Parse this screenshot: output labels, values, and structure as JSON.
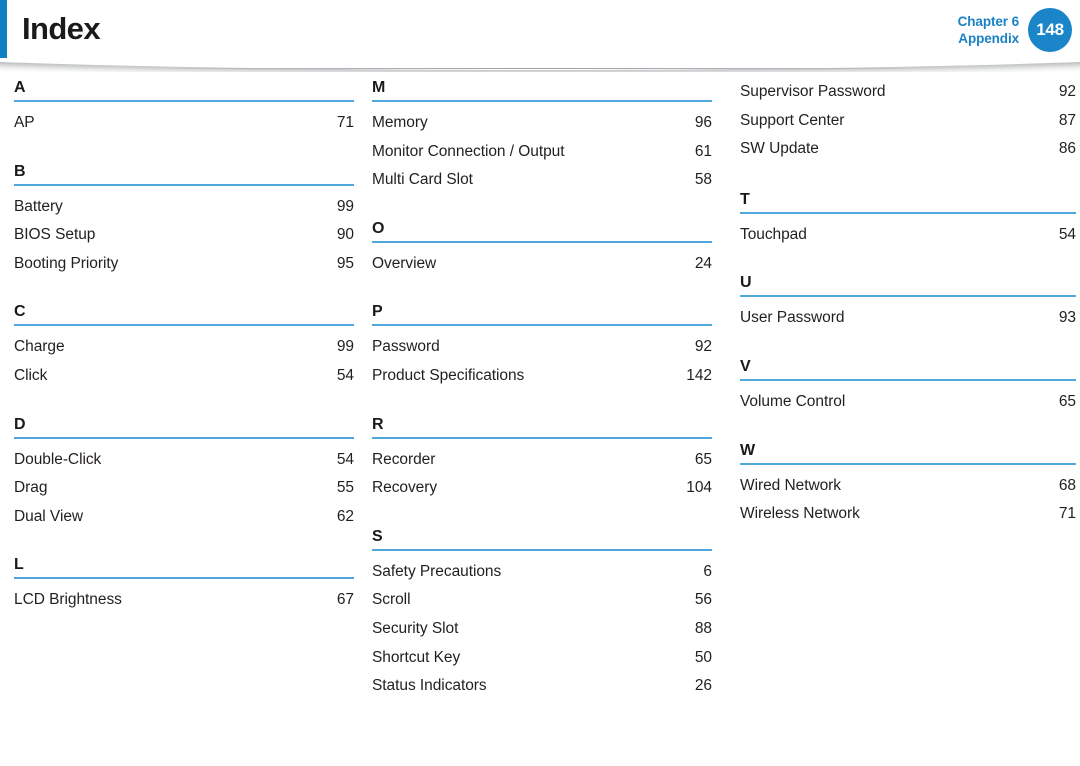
{
  "header": {
    "title": "Index",
    "chapter_line1": "Chapter 6",
    "chapter_line2": "Appendix",
    "page_number": "148",
    "accent_color": "#0f7fc4",
    "badge_color": "#1a86c9",
    "rule_color": "#4fa8dd"
  },
  "columns": [
    {
      "id": "column-1",
      "lead_entries": [],
      "groups": [
        {
          "letter": "A",
          "entries": [
            {
              "term": "AP",
              "page": "71"
            }
          ]
        },
        {
          "letter": "B",
          "entries": [
            {
              "term": "Battery",
              "page": "99"
            },
            {
              "term": "BIOS Setup",
              "page": "90"
            },
            {
              "term": "Booting Priority",
              "page": "95"
            }
          ]
        },
        {
          "letter": "C",
          "entries": [
            {
              "term": "Charge",
              "page": "99"
            },
            {
              "term": "Click",
              "page": "54"
            }
          ]
        },
        {
          "letter": "D",
          "entries": [
            {
              "term": "Double-Click",
              "page": "54"
            },
            {
              "term": "Drag",
              "page": "55"
            },
            {
              "term": "Dual View",
              "page": "62"
            }
          ]
        },
        {
          "letter": "L",
          "entries": [
            {
              "term": "LCD Brightness",
              "page": "67"
            }
          ]
        }
      ]
    },
    {
      "id": "column-2",
      "lead_entries": [],
      "groups": [
        {
          "letter": "M",
          "entries": [
            {
              "term": "Memory",
              "page": "96"
            },
            {
              "term": "Monitor Connection / Output",
              "page": "61"
            },
            {
              "term": "Multi Card Slot",
              "page": "58"
            }
          ]
        },
        {
          "letter": "O",
          "entries": [
            {
              "term": "Overview",
              "page": "24"
            }
          ]
        },
        {
          "letter": "P",
          "entries": [
            {
              "term": "Password",
              "page": "92"
            },
            {
              "term": "Product Specifications",
              "page": "142"
            }
          ]
        },
        {
          "letter": "R",
          "entries": [
            {
              "term": "Recorder",
              "page": "65"
            },
            {
              "term": "Recovery",
              "page": "104"
            }
          ]
        },
        {
          "letter": "S",
          "entries": [
            {
              "term": "Safety Precautions",
              "page": "6"
            },
            {
              "term": "Scroll",
              "page": "56"
            },
            {
              "term": "Security Slot",
              "page": "88"
            },
            {
              "term": "Shortcut Key",
              "page": "50"
            },
            {
              "term": "Status Indicators",
              "page": "26"
            }
          ]
        }
      ]
    },
    {
      "id": "column-3",
      "lead_entries": [
        {
          "term": "Supervisor Password",
          "page": "92"
        },
        {
          "term": "Support Center",
          "page": "87"
        },
        {
          "term": "SW Update",
          "page": "86"
        }
      ],
      "groups": [
        {
          "letter": "T",
          "entries": [
            {
              "term": "Touchpad",
              "page": "54"
            }
          ]
        },
        {
          "letter": "U",
          "entries": [
            {
              "term": "User Password",
              "page": "93"
            }
          ]
        },
        {
          "letter": "V",
          "entries": [
            {
              "term": "Volume Control",
              "page": "65"
            }
          ]
        },
        {
          "letter": "W",
          "entries": [
            {
              "term": "Wired Network",
              "page": "68"
            },
            {
              "term": "Wireless Network",
              "page": "71"
            }
          ]
        }
      ]
    }
  ]
}
